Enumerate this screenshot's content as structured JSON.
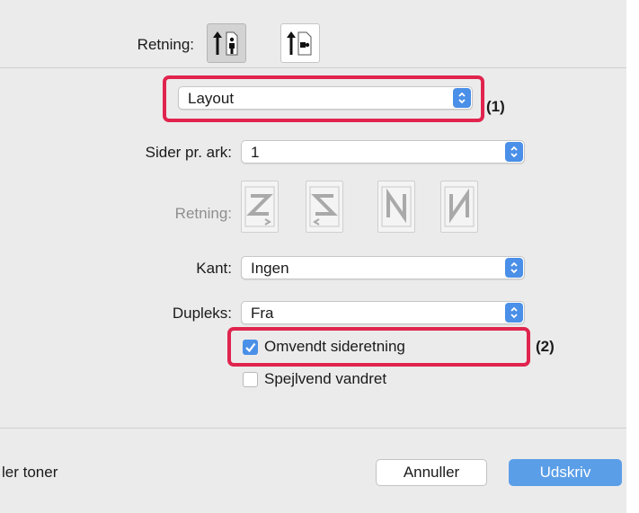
{
  "orientation": {
    "label": "Retning:",
    "options": [
      {
        "name": "portrait",
        "icon": "portrait-orientation-icon",
        "selected": true
      },
      {
        "name": "landscape",
        "icon": "landscape-orientation-icon",
        "selected": false
      }
    ]
  },
  "section_menu": {
    "value": "Layout",
    "callout": "(1)"
  },
  "pages_per_sheet": {
    "label": "Sider pr. ark:",
    "value": "1"
  },
  "layout_direction": {
    "label": "Retning:",
    "enabled": false,
    "options": [
      "z-layout-icon",
      "reverse-z-layout-icon",
      "n-layout-icon",
      "reverse-n-layout-icon"
    ]
  },
  "border": {
    "label": "Kant:",
    "value": "Ingen"
  },
  "duplex": {
    "label": "Dupleks:",
    "value": "Fra"
  },
  "reverse_orientation": {
    "label": "Omvendt sideretning",
    "checked": true,
    "callout": "(2)"
  },
  "flip_horizontal": {
    "label": "Spejlvend vandret",
    "checked": false
  },
  "footer": {
    "left_text": "ler toner",
    "cancel_label": "Annuller",
    "print_label": "Udskriv"
  },
  "colors": {
    "highlight": "#e0244e",
    "accent": "#4a8fe8",
    "primary_button": "#5b9ee8"
  }
}
